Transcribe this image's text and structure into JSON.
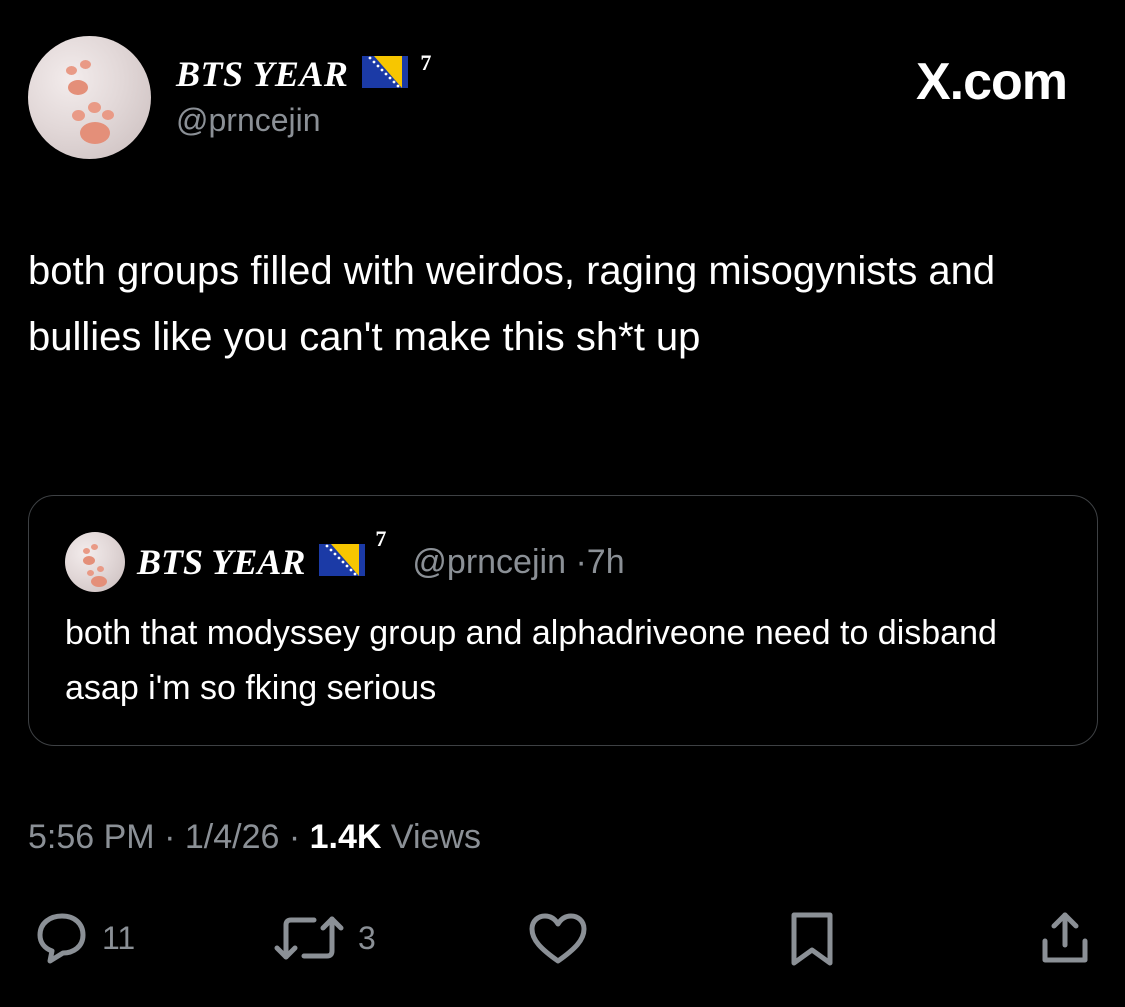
{
  "tweet": {
    "author": {
      "display_name": "BTS YEAR",
      "badge_number": "7",
      "handle": "@prncejin",
      "flag": "bosnia-flag"
    },
    "brand": "X.com",
    "text": "both groups filled with weirdos, raging misogynists and bullies like you can't make this sh*t up",
    "timestamp": "5:56 PM",
    "date": "1/4/26",
    "views_count": "1.4K",
    "views_label": "Views"
  },
  "quoted": {
    "display_name": "BTS YEAR",
    "badge_number": "7",
    "handle": "@prncejin",
    "age": "7h",
    "text": "both that modyssey group and alphadriveone need to disband asap i'm so fking serious"
  },
  "actions": {
    "replies": "11",
    "reposts": "3"
  },
  "colors": {
    "background": "#000000",
    "text": "#ffffff",
    "secondary": "#8b9096",
    "border": "#3e4144"
  }
}
